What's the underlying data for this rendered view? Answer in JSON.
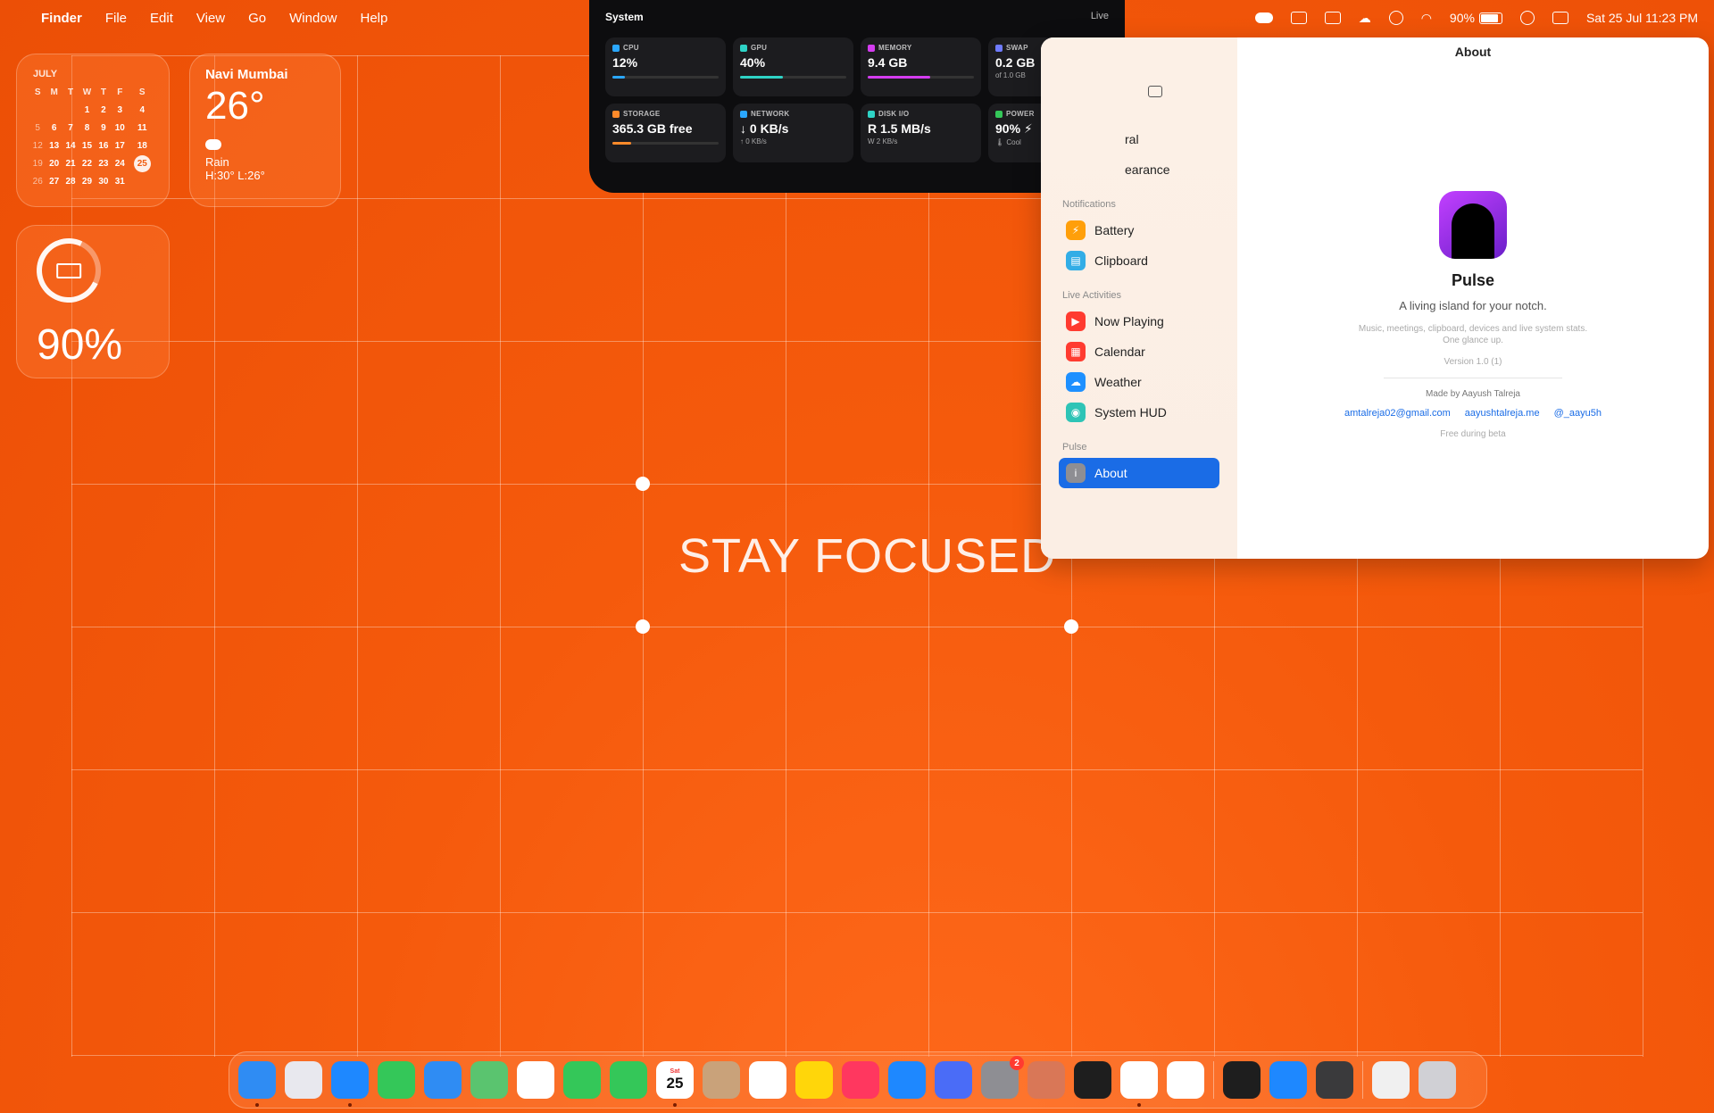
{
  "menubar": {
    "app_name": "Finder",
    "menus": [
      "File",
      "Edit",
      "View",
      "Go",
      "Window",
      "Help"
    ],
    "battery_pct": "90%",
    "datetime": "Sat 25 Jul  11:23 PM"
  },
  "calendar_widget": {
    "month": "JULY",
    "weekdays": [
      "S",
      "M",
      "T",
      "W",
      "T",
      "F",
      "S"
    ],
    "weeks": [
      [
        "",
        "",
        "",
        "1",
        "2",
        "3",
        "4"
      ],
      [
        "5",
        "6",
        "7",
        "8",
        "9",
        "10",
        "11"
      ],
      [
        "12",
        "13",
        "14",
        "15",
        "16",
        "17",
        "18"
      ],
      [
        "19",
        "20",
        "21",
        "22",
        "23",
        "24",
        "25"
      ],
      [
        "26",
        "27",
        "28",
        "29",
        "30",
        "31",
        ""
      ]
    ],
    "today": "25"
  },
  "weather_widget": {
    "city": "Navi Mumbai",
    "temp": "26°",
    "condition": "Rain",
    "high_low": "H:30° L:26°"
  },
  "battery_widget": {
    "percent": "90%",
    "level": 0.9
  },
  "system_panel": {
    "title": "System",
    "status": "Live",
    "tiles": [
      {
        "label": "CPU",
        "value": "12%",
        "sub": "",
        "color": "#2aa7ff",
        "bar": 0.12
      },
      {
        "label": "GPU",
        "value": "40%",
        "sub": "",
        "color": "#2ed3c6",
        "bar": 0.4
      },
      {
        "label": "MEMORY",
        "value": "9.4 GB",
        "sub": "",
        "color": "#d43cf0",
        "bar": 0.59
      },
      {
        "label": "SWAP",
        "value": "0.2 GB",
        "sub": "of 1.0 GB",
        "color": "#6f7bff",
        "bar": null
      },
      {
        "label": "STORAGE",
        "value": "365.3 GB free",
        "sub": "",
        "color": "#ff8a2a",
        "bar": 0.18
      },
      {
        "label": "NETWORK",
        "value": "↓ 0 KB/s",
        "sub": "↑ 0 KB/s",
        "color": "#2aa7ff",
        "bar": null
      },
      {
        "label": "DISK I/O",
        "value": "R 1.5 MB/s",
        "sub": "W 2 KB/s",
        "color": "#2ed3c6",
        "bar": null
      },
      {
        "label": "POWER",
        "value": "90% ⚡",
        "sub": "🌡 Cool",
        "color": "#34c759",
        "bar": null
      }
    ]
  },
  "settings_window": {
    "title": "About",
    "partial_items": [
      "ral",
      "earance"
    ],
    "sections": [
      {
        "name": "Notifications",
        "items": [
          {
            "label": "Battery",
            "color": "#ff9f0a",
            "glyph": "⚡"
          },
          {
            "label": "Clipboard",
            "color": "#32ade6",
            "glyph": "▤"
          }
        ]
      },
      {
        "name": "Live Activities",
        "items": [
          {
            "label": "Now Playing",
            "color": "#ff3b30",
            "glyph": "▶"
          },
          {
            "label": "Calendar",
            "color": "#ff3b30",
            "glyph": "▦"
          },
          {
            "label": "Weather",
            "color": "#1e90ff",
            "glyph": "☁"
          },
          {
            "label": "System HUD",
            "color": "#2ec4b6",
            "glyph": "◉"
          }
        ]
      },
      {
        "name": "Pulse",
        "items": [
          {
            "label": "About",
            "color": "#8e8e93",
            "glyph": "i",
            "active": true
          }
        ]
      }
    ],
    "about": {
      "app_name": "Pulse",
      "tagline": "A living island for your notch.",
      "description_line1": "Music, meetings, clipboard, devices and live system stats.",
      "description_line2": "One glance up.",
      "version": "Version 1.0 (1)",
      "made_by": "Made by Aayush Talreja",
      "links": [
        "amtalreja02@gmail.com",
        "aayushtalreja.me",
        "@_aayu5h"
      ],
      "note": "Free during beta"
    }
  },
  "wallpaper": {
    "text": "STAY FOCUSED"
  },
  "dock": {
    "calendar_day_label": "Sat",
    "calendar_day": "25",
    "settings_badge": "2",
    "apps": [
      {
        "name": "finder",
        "color": "#2f8cf3",
        "running": true
      },
      {
        "name": "launchpad",
        "color": "#e8e8ee",
        "running": false
      },
      {
        "name": "safari",
        "color": "#1e88ff",
        "running": true
      },
      {
        "name": "messages",
        "color": "#34c759",
        "running": false
      },
      {
        "name": "mail",
        "color": "#2f8cf3",
        "running": false
      },
      {
        "name": "maps",
        "color": "#5ac46f",
        "running": false
      },
      {
        "name": "photos",
        "color": "#ffffff",
        "running": false
      },
      {
        "name": "facetime",
        "color": "#34c759",
        "running": false
      },
      {
        "name": "phone",
        "color": "#34c759",
        "running": false
      },
      {
        "name": "calendar",
        "color": "#ffffff",
        "running": true
      },
      {
        "name": "contacts",
        "color": "#c9a27a",
        "running": false
      },
      {
        "name": "reminders",
        "color": "#ffffff",
        "running": false
      },
      {
        "name": "notes",
        "color": "#ffd60a",
        "running": false
      },
      {
        "name": "music",
        "color": "#ff375f",
        "running": false
      },
      {
        "name": "app-store",
        "color": "#1e88ff",
        "running": false
      },
      {
        "name": "iphone-mirroring",
        "color": "#4a6cf7",
        "running": false
      },
      {
        "name": "system-settings",
        "color": "#8e8e93",
        "running": false
      },
      {
        "name": "claude",
        "color": "#d97757",
        "running": false
      },
      {
        "name": "figma",
        "color": "#1e1e1e",
        "running": false
      },
      {
        "name": "chrome",
        "color": "#ffffff",
        "running": true
      },
      {
        "name": "slack",
        "color": "#ffffff",
        "running": false
      },
      {
        "name": "terminal",
        "color": "#1e1e1e",
        "running": false
      },
      {
        "name": "xcode",
        "color": "#1e88ff",
        "running": false
      },
      {
        "name": "calculator",
        "color": "#3a3a3c",
        "running": false
      },
      {
        "name": "downloads",
        "color": "#f0f0f0",
        "running": false
      },
      {
        "name": "trash",
        "color": "#d0d0d5",
        "running": false
      }
    ]
  }
}
